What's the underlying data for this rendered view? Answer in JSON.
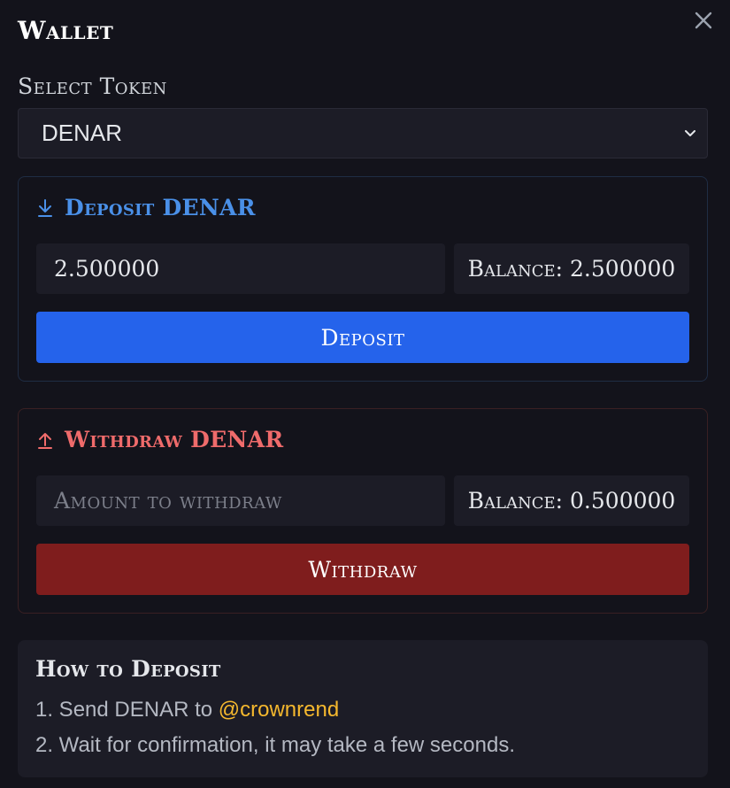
{
  "wallet": {
    "title": "Wallet"
  },
  "token_select": {
    "label": "Select Token",
    "selected": "DENAR"
  },
  "deposit": {
    "header": "Deposit DENAR",
    "amount_value": "2.500000",
    "balance": "Balance: 2.500000",
    "button_label": "Deposit",
    "color": "#4a90e8",
    "button_color": "#2563eb"
  },
  "withdraw": {
    "header": "Withdraw DENAR",
    "amount_placeholder": "Amount to withdraw",
    "balance": "Balance: 0.500000",
    "button_label": "Withdraw",
    "color": "#ef6b6b",
    "button_color": "#7f1d1d"
  },
  "howto": {
    "title": "How to Deposit",
    "step1_prefix": "1. Send DENAR to ",
    "step1_handle": "@crownrend",
    "step2": "2. Wait for confirmation, it may take a few seconds."
  },
  "icons": {
    "close": "close-icon",
    "select_arrow": "chevron-down-icon",
    "deposit": "arrow-down-icon",
    "withdraw": "arrow-up-icon"
  }
}
